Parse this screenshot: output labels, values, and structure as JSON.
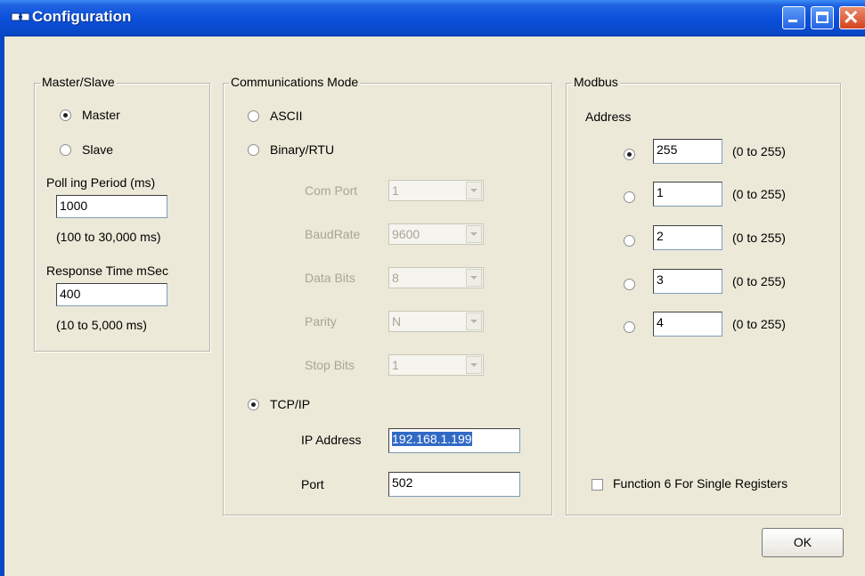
{
  "window": {
    "title": "Configuration"
  },
  "master_slave": {
    "legend": "Master/Slave",
    "master_label": "Master",
    "slave_label": "Slave",
    "polling_label": "Poll ing Period (ms)",
    "polling_value": "1000",
    "polling_range": "(100 to 30,000 ms)",
    "response_label": "Response Time mSec",
    "response_value": "400",
    "response_range": "(10 to 5,000 ms)"
  },
  "comms": {
    "legend": "Communications Mode",
    "ascii_label": "ASCII",
    "binary_label": "Binary/RTU",
    "com_port_label": "Com Port",
    "com_port_value": "1",
    "baud_label": "BaudRate",
    "baud_value": "9600",
    "data_bits_label": "Data Bits",
    "data_bits_value": "8",
    "parity_label": "Parity",
    "parity_value": "N",
    "stop_bits_label": "Stop Bits",
    "stop_bits_value": "1",
    "tcpip_label": "TCP/IP",
    "ip_label": "IP Address",
    "ip_value": "192.168.1.199",
    "port_label": "Port",
    "port_value": "502"
  },
  "modbus": {
    "legend": "Modbus",
    "address_label": "Address",
    "addresses": [
      {
        "value": "255",
        "range": "(0 to 255)"
      },
      {
        "value": "1",
        "range": "(0 to 255)"
      },
      {
        "value": "2",
        "range": "(0 to 255)"
      },
      {
        "value": "3",
        "range": "(0 to 255)"
      },
      {
        "value": "4",
        "range": "(0 to 255)"
      }
    ],
    "function6_label": "Function 6 For Single Registers"
  },
  "ok_label": "OK"
}
